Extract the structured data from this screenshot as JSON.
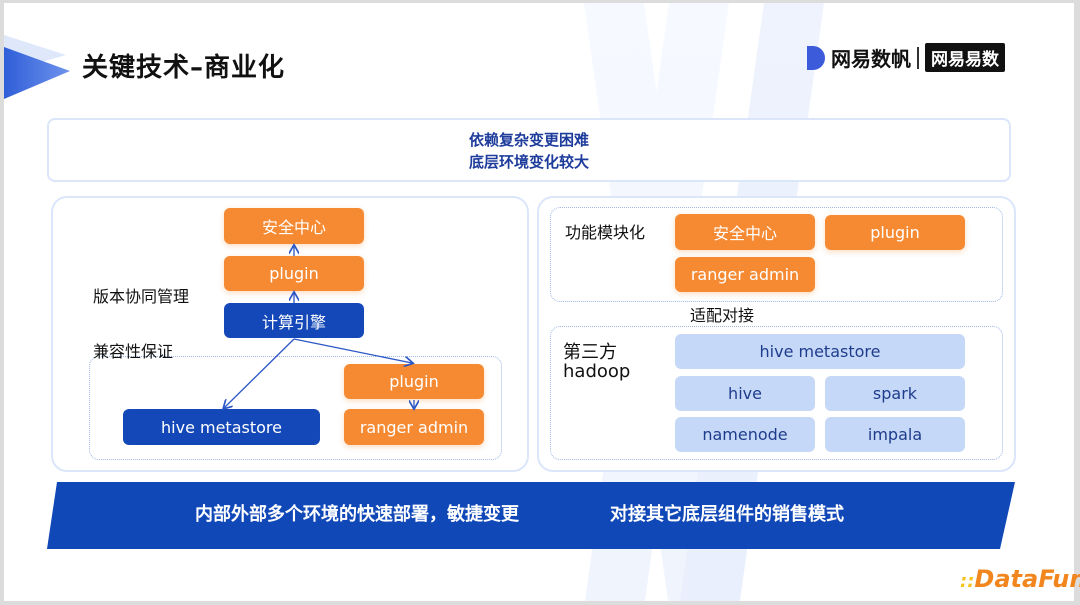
{
  "header": {
    "title": "关键技术–商业化",
    "logo_primary": "网易数帆",
    "logo_secondary": "网易易数"
  },
  "challenge_box": {
    "line1": "依赖复杂变更困难",
    "line2": "底层环境变化较大"
  },
  "left_panel": {
    "label_version": "版本协同管理",
    "label_compat": "兼容性保证",
    "nodes": {
      "security_center": "安全中心",
      "plugin_top": "plugin",
      "compute_engine": "计算引擎",
      "hive_metastore": "hive metastore",
      "plugin_bottom": "plugin",
      "ranger_admin": "ranger admin"
    }
  },
  "right_panel": {
    "label_modular": "功能模块化",
    "label_adapt": "适配对接",
    "label_third_party_1": "第三方",
    "label_third_party_2": "hadoop",
    "modules": [
      "安全中心",
      "plugin",
      "ranger admin"
    ],
    "hadoop": [
      "hive metastore",
      "hive",
      "spark",
      "namenode",
      "impala"
    ]
  },
  "banner": {
    "left": "内部外部多个环境的快速部署，敏捷变更",
    "right": "对接其它底层组件的销售模式"
  },
  "watermark": {
    "dots": "::",
    "text": "DataFun."
  },
  "colors": {
    "orange": "#f68a33",
    "dark_blue": "#1448b8",
    "light_blue": "#c6d8f7",
    "banner_blue": "#1148b8"
  }
}
